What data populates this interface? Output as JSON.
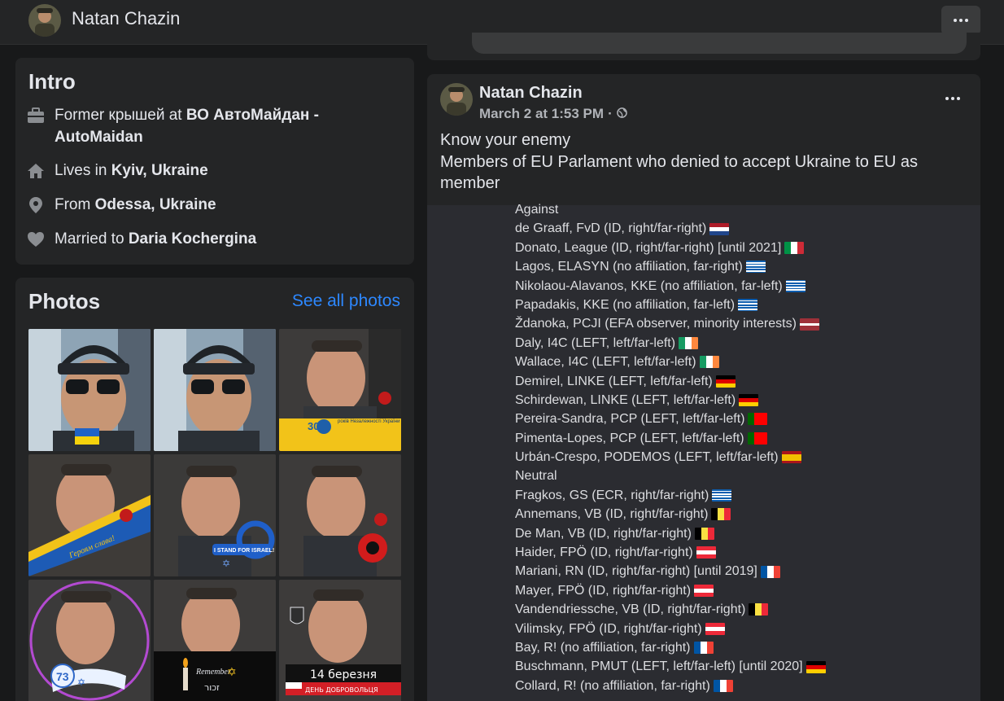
{
  "header": {
    "profile_name": "Natan Chazin",
    "more_icon": "ellipsis-icon"
  },
  "intro": {
    "title": "Intro",
    "items": [
      {
        "icon": "briefcase-icon",
        "prefix": "Former крышей at ",
        "bold": "ВО АвтоМайдан - AutoMaidan"
      },
      {
        "icon": "home-icon",
        "prefix": "Lives in ",
        "bold": "Kyiv, Ukraine"
      },
      {
        "icon": "location-pin-icon",
        "prefix": "From ",
        "bold": "Odessa, Ukraine"
      },
      {
        "icon": "heart-icon",
        "prefix": "Married to ",
        "bold": "Daria Kochergina"
      }
    ]
  },
  "photos": {
    "title": "Photos",
    "see_all": "See all photos",
    "overlay_texts": {
      "ukraine_30": "років Незалежності України",
      "heroiam_slava": "Героям слава!",
      "stand_for_israel": "I STAND FOR ISRAEL!",
      "remember": "Remember",
      "zakhor": "זכור",
      "march_14": "14 березня",
      "volunteer_day": "ДЕНЬ ДОБРОВОЛЬЦЯ",
      "israel_73": "73",
      "year_30": "30"
    }
  },
  "post": {
    "author": "Natan Chazin",
    "date": "March 2 at 1:53 PM",
    "privacy_icon": "globe-icon",
    "text_lines": [
      "Know your enemy",
      "Members of EU Parlament who denied to accept Ukraine to EU as member"
    ],
    "listing": [
      {
        "text": "Against",
        "flag": ""
      },
      {
        "text": "de Graaff, FvD (ID, right/far-right)",
        "flag": "nl"
      },
      {
        "text": "Donato, League (ID, right/far-right) [until 2021]",
        "flag": "it"
      },
      {
        "text": "Lagos, ELASYN (no affiliation, far-right)",
        "flag": "gr"
      },
      {
        "text": "Nikolaou-Alavanos, KKE  (no affiliation, far-left)",
        "flag": "gr"
      },
      {
        "text": "Papadakis, KKE (no affiliation, far-left)",
        "flag": "gr"
      },
      {
        "text": "Ždanoka, PCJI (EFA observer, minority interests)",
        "flag": "lv"
      },
      {
        "text": "Daly, I4C (LEFT, left/far-left)",
        "flag": "ie"
      },
      {
        "text": "Wallace, I4C (LEFT, left/far-left)",
        "flag": "ie"
      },
      {
        "text": "Demirel, LINKE (LEFT, left/far-left)",
        "flag": "de"
      },
      {
        "text": "Schirdewan, LINKE (LEFT, left/far-left)",
        "flag": "de"
      },
      {
        "text": "Pereira-Sandra, PCP (LEFT, left/far-left)",
        "flag": "pt"
      },
      {
        "text": "Pimenta-Lopes, PCP (LEFT, left/far-left)",
        "flag": "pt"
      },
      {
        "text": "Urbán-Crespo, PODEMOS (LEFT, left/far-left)",
        "flag": "es"
      },
      {
        "text": "Neutral",
        "flag": ""
      },
      {
        "text": "Fragkos, GS (ECR, right/far-right)",
        "flag": "gr"
      },
      {
        "text": "Annemans, VB (ID, right/far-right)",
        "flag": "be"
      },
      {
        "text": "De Man, VB (ID, right/far-right)",
        "flag": "be"
      },
      {
        "text": "Haider, FPÖ (ID, right/far-right)",
        "flag": "at"
      },
      {
        "text": "Mariani, RN (ID, right/far-right) [until 2019]",
        "flag": "fr"
      },
      {
        "text": "Mayer, FPÖ (ID, right/far-right)",
        "flag": "at"
      },
      {
        "text": "Vandendriessche, VB (ID, right/far-right)",
        "flag": "be"
      },
      {
        "text": "Vilimsky, FPÖ (ID, right/far-right)",
        "flag": "at"
      },
      {
        "text": "Bay, R! (no affiliation, far-right)",
        "flag": "fr"
      },
      {
        "text": "Buschmann, PMUT (LEFT, left/far-left) [until 2020]",
        "flag": "de"
      },
      {
        "text": "Collard, R! (no affiliation, far-right)",
        "flag": "fr"
      }
    ]
  },
  "colors": {
    "page_bg": "#18191a",
    "card_bg": "#242526",
    "link": "#2d88ff",
    "text_secondary": "#b0b3b8"
  }
}
